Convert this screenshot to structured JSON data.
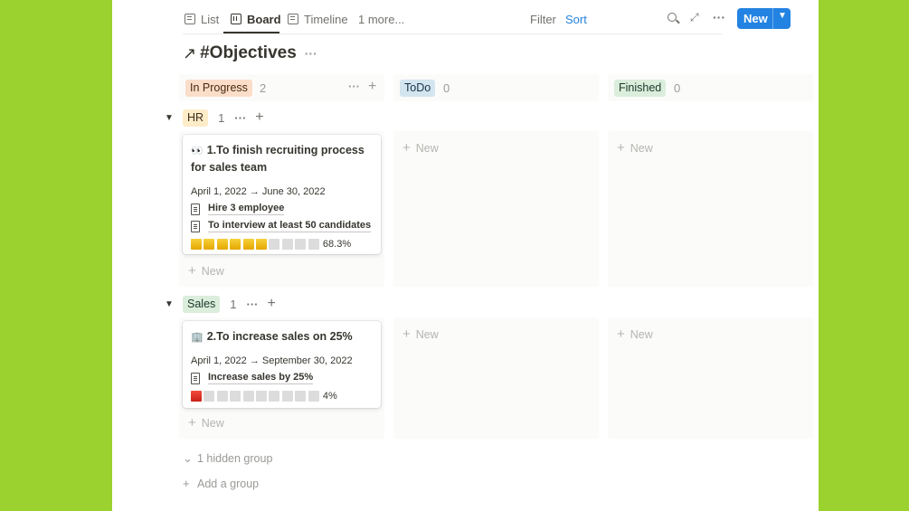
{
  "views": {
    "tabs": [
      {
        "label": "List",
        "icon": "list-icon"
      },
      {
        "label": "Board",
        "icon": "board-icon"
      },
      {
        "label": "Timeline",
        "icon": "timeline-icon"
      }
    ],
    "more_label": "1 more...",
    "filter_label": "Filter",
    "sort_label": "Sort",
    "new_label": "New",
    "active_tab": "Board"
  },
  "page": {
    "title_icon": "↗",
    "title": "#Objectives"
  },
  "columns": [
    {
      "label": "In Progress",
      "color": "orange",
      "count": "2"
    },
    {
      "label": "ToDo",
      "color": "blue",
      "count": "0"
    },
    {
      "label": "Finished",
      "color": "green",
      "count": "0"
    }
  ],
  "groups": [
    {
      "label": "HR",
      "count": "1",
      "card": {
        "emoji": "👀",
        "title": "1.To finish recruiting process for sales team",
        "dates": "April 1, 2022 → June 30, 2022",
        "relations": [
          "Hire 3 employee",
          "To interview at least 50 candidates"
        ],
        "progress_filled": 6,
        "progress_total": 10,
        "progress_color": "yellow",
        "progress_label": "68.3%"
      }
    },
    {
      "label": "Sales",
      "count": "1",
      "card": {
        "emoji": "🏢",
        "title": "2.To increase sales on 25%",
        "dates": "April 1, 2022 → September 30, 2022",
        "relations": [
          "Increase sales by 25%"
        ],
        "progress_filled": 1,
        "progress_total": 10,
        "progress_color": "red",
        "progress_label": "4%"
      }
    }
  ],
  "new_label": "New",
  "hidden_groups_label": "1 hidden group",
  "add_group_label": "Add a group",
  "colors": {
    "background": "#9bd22f",
    "accent": "#2383e2"
  }
}
